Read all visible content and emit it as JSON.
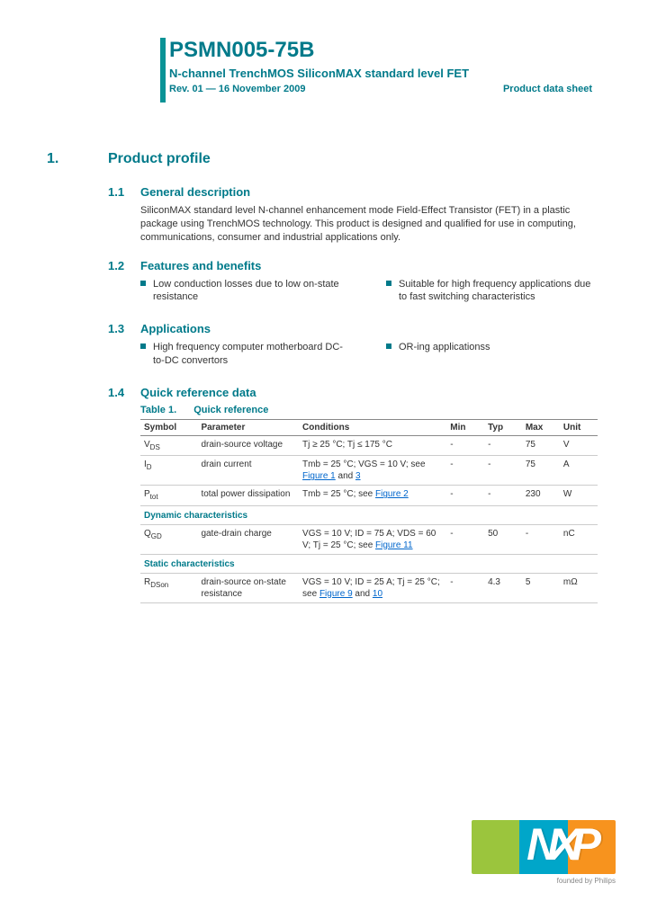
{
  "header": {
    "title": "PSMN005-75B",
    "subtitle": "N-channel TrenchMOS SiliconMAX standard level FET",
    "rev": "Rev. 01 — 16 November 2009",
    "doctype": "Product data sheet"
  },
  "section1": {
    "num": "1.",
    "title": "Product profile"
  },
  "s11": {
    "num": "1.1",
    "title": "General description",
    "body": "SiliconMAX standard level N-channel enhancement mode Field-Effect Transistor (FET) in a plastic package using TrenchMOS technology. This product is designed and qualified for use in computing, communications, consumer and industrial applications only."
  },
  "s12": {
    "num": "1.2",
    "title": "Features and benefits",
    "b1": "Low conduction losses due to low on-state resistance",
    "b2": "Suitable for high frequency applications due to fast switching characteristics"
  },
  "s13": {
    "num": "1.3",
    "title": "Applications",
    "b1": "High frequency computer motherboard DC-to-DC convertors",
    "b2": "OR-ing applicationss"
  },
  "s14": {
    "num": "1.4",
    "title": "Quick reference data"
  },
  "table": {
    "caption_num": "Table 1.",
    "caption_title": "Quick reference",
    "head": {
      "c1": "Symbol",
      "c2": "Parameter",
      "c3": "Conditions",
      "c4": "Min",
      "c5": "Typ",
      "c6": "Max",
      "c7": "Unit"
    },
    "rows": [
      {
        "sym": "V",
        "sub": "DS",
        "par": "drain-source voltage",
        "cond": "Tj ≥ 25 °C; Tj ≤ 175 °C",
        "min": "-",
        "typ": "-",
        "max": "75",
        "unit": "V"
      },
      {
        "sym": "I",
        "sub": "D",
        "par": "drain current",
        "cond_pre": "Tmb = 25 °C; VGS = 10 V; see ",
        "link1": "Figure 1",
        "mid": " and ",
        "link2": "3",
        "min": "-",
        "typ": "-",
        "max": "75",
        "unit": "A"
      },
      {
        "sym": "P",
        "sub": "tot",
        "par": "total power dissipation",
        "cond_pre": "Tmb = 25 °C; see ",
        "link1": "Figure 2",
        "min": "-",
        "typ": "-",
        "max": "230",
        "unit": "W"
      }
    ],
    "dyn_label": "Dynamic characteristics",
    "dyn_row": {
      "sym": "Q",
      "sub": "GD",
      "par": "gate-drain charge",
      "cond_pre": "VGS = 10 V; ID = 75 A; VDS = 60 V; Tj = 25 °C; see ",
      "link1": "Figure 11",
      "min": "-",
      "typ": "50",
      "max": "-",
      "unit": "nC"
    },
    "stat_label": "Static characteristics",
    "stat_row": {
      "sym": "R",
      "sub": "DSon",
      "par": "drain-source on-state resistance",
      "cond_pre": "VGS = 10 V; ID = 25 A; Tj = 25 °C; see ",
      "link1": "Figure 9",
      "mid": " and ",
      "link2": "10",
      "min": "-",
      "typ": "4.3",
      "max": "5",
      "unit": "mΩ"
    }
  },
  "logo": {
    "text": "NP",
    "tag": "founded by Philips"
  }
}
